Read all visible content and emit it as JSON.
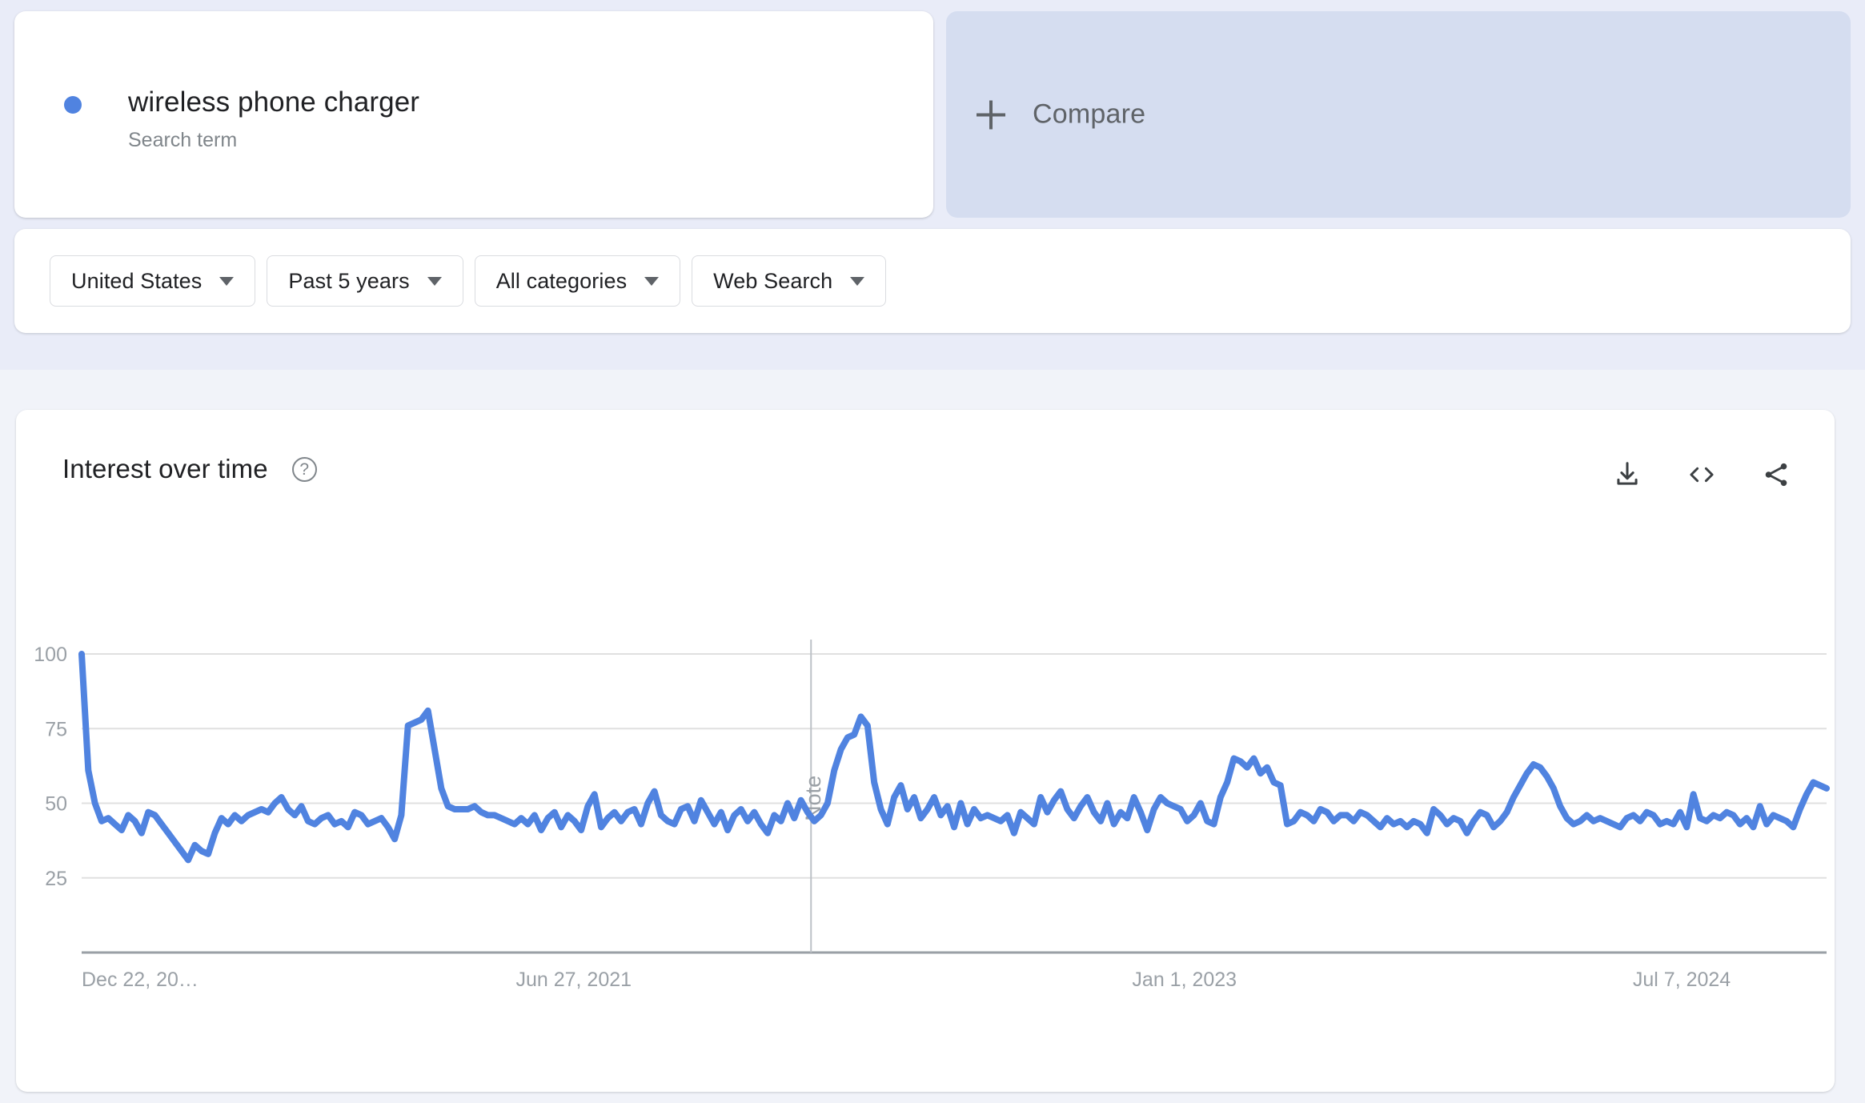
{
  "search_term": {
    "title": "wireless phone charger",
    "subtitle": "Search term",
    "dot_color": "#5083e0"
  },
  "compare": {
    "label": "Compare",
    "plus_icon": "plus-icon"
  },
  "filters": [
    {
      "label": "United States",
      "name": "location"
    },
    {
      "label": "Past 5 years",
      "name": "time-range"
    },
    {
      "label": "All categories",
      "name": "category"
    },
    {
      "label": "Web Search",
      "name": "search-type"
    }
  ],
  "chart_card": {
    "title": "Interest over time",
    "help_icon": "?",
    "actions": [
      {
        "name": "download-csv-icon",
        "label": "download"
      },
      {
        "name": "embed-code-icon",
        "label": "embed"
      },
      {
        "name": "share-icon",
        "label": "share"
      }
    ]
  },
  "chart_data": {
    "type": "line",
    "title": "Interest over time",
    "xlabel": "",
    "ylabel": "",
    "ylim": [
      0,
      100
    ],
    "yticks": [
      100,
      75,
      50,
      25
    ],
    "grid": true,
    "legend": false,
    "series_color": "#5083e0",
    "x_tick_labels": [
      "Dec 22, 20…",
      "Jun 27, 2021",
      "Jan 1, 2023",
      "Jul 7, 2024"
    ],
    "x_tick_positions": [
      0,
      0.282,
      0.632,
      0.917
    ],
    "annotations": [
      {
        "label": "Note",
        "x_fraction": 0.418,
        "orientation": "vertical"
      }
    ],
    "series": [
      {
        "name": "wireless phone charger",
        "values": [
          100,
          61,
          50,
          44,
          45,
          43,
          41,
          46,
          44,
          40,
          47,
          46,
          43,
          40,
          37,
          34,
          31,
          36,
          34,
          33,
          40,
          45,
          43,
          46,
          44,
          46,
          47,
          48,
          47,
          50,
          52,
          48,
          46,
          49,
          44,
          43,
          45,
          46,
          43,
          44,
          42,
          47,
          46,
          43,
          44,
          45,
          42,
          38,
          46,
          76,
          77,
          78,
          81,
          68,
          55,
          49,
          48,
          48,
          48,
          49,
          47,
          46,
          46,
          45,
          44,
          43,
          45,
          43,
          46,
          41,
          45,
          47,
          42,
          46,
          44,
          41,
          49,
          53,
          42,
          45,
          47,
          44,
          47,
          48,
          43,
          50,
          54,
          46,
          44,
          43,
          48,
          49,
          44,
          51,
          47,
          43,
          47,
          41,
          46,
          48,
          44,
          47,
          43,
          40,
          46,
          44,
          50,
          45,
          51,
          47,
          44,
          46,
          50,
          61,
          68,
          72,
          73,
          79,
          76,
          57,
          48,
          43,
          52,
          56,
          48,
          52,
          45,
          48,
          52,
          46,
          49,
          42,
          50,
          43,
          48,
          45,
          46,
          45,
          44,
          46,
          40,
          47,
          45,
          43,
          52,
          47,
          51,
          54,
          48,
          45,
          49,
          52,
          47,
          44,
          50,
          43,
          47,
          45,
          52,
          47,
          41,
          48,
          52,
          50,
          49,
          48,
          44,
          46,
          50,
          44,
          43,
          52,
          57,
          65,
          64,
          62,
          65,
          60,
          62,
          57,
          56,
          43,
          44,
          47,
          46,
          44,
          48,
          47,
          44,
          46,
          46,
          44,
          47,
          46,
          44,
          42,
          45,
          43,
          44,
          42,
          44,
          43,
          40,
          48,
          46,
          43,
          45,
          44,
          40,
          44,
          47,
          46,
          42,
          44,
          47,
          52,
          56,
          60,
          63,
          62,
          59,
          55,
          49,
          45,
          43,
          44,
          46,
          44,
          45,
          44,
          43,
          42,
          45,
          46,
          44,
          47,
          46,
          43,
          44,
          43,
          47,
          42,
          53,
          45,
          44,
          46,
          45,
          47,
          46,
          43,
          45,
          42,
          49,
          43,
          46,
          45,
          44,
          42,
          48,
          53,
          57,
          56,
          55
        ]
      }
    ]
  }
}
